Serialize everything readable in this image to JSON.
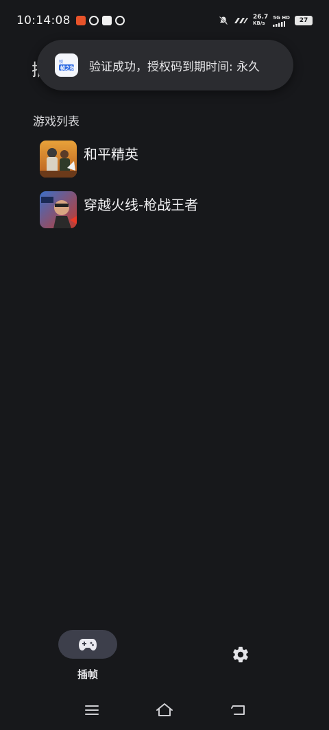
{
  "status_bar": {
    "time": "10:14:08",
    "net_speed_value": "26.7",
    "net_speed_unit": "KB/s",
    "signal_label": "5G HD",
    "battery": "27",
    "colors": {
      "notif1": "#e8532a",
      "notif2": "#f2f2f2",
      "notif3": "#f2f2f2",
      "notif4": "#f2f2f2"
    }
  },
  "page": {
    "title_partial": "插"
  },
  "toast": {
    "message": "验证成功，授权码到期时间: 永久",
    "app_icon": "app-logo-icon"
  },
  "game_section": {
    "label": "游戏列表",
    "games": [
      {
        "name": "和平精英",
        "icon": "peacekeeper-elite-icon"
      },
      {
        "name": "穿越火线-枪战王者",
        "icon": "crossfire-icon"
      }
    ]
  },
  "bottom_nav": {
    "tabs": [
      {
        "label": "插帧",
        "icon": "gamepad-icon",
        "active": true
      },
      {
        "label": "",
        "icon": "gear-icon",
        "active": false
      }
    ],
    "active_pill_color": "#3d3f4b"
  },
  "system_nav": {
    "buttons": [
      "menu-icon",
      "home-icon",
      "back-icon"
    ]
  }
}
